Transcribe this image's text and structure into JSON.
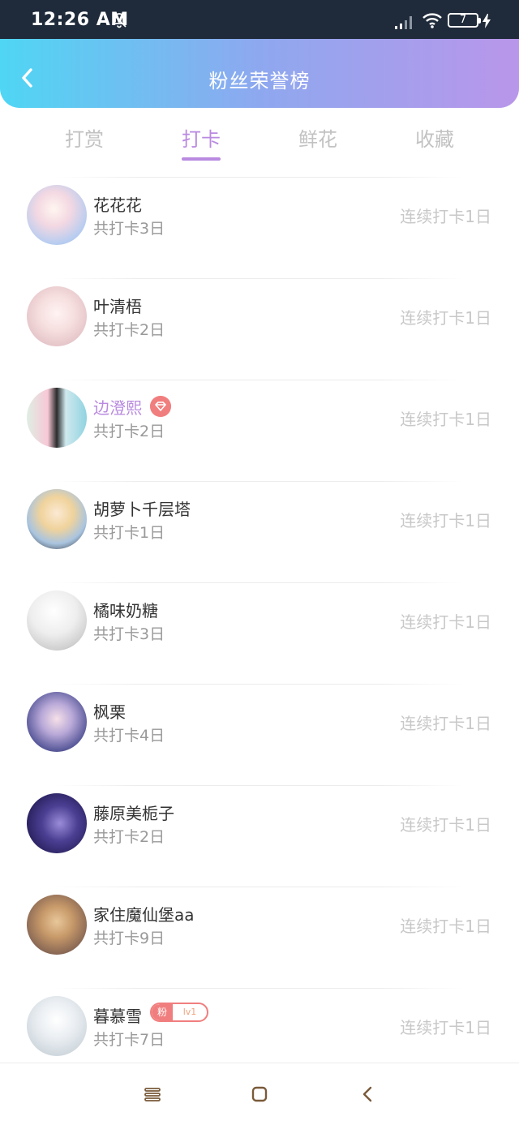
{
  "status_bar": {
    "time": "12:26 AM",
    "battery": "7"
  },
  "header": {
    "title": "粉丝荣誉榜"
  },
  "tabs": [
    {
      "label": "打赏",
      "active": false
    },
    {
      "label": "打卡",
      "active": true
    },
    {
      "label": "鲜花",
      "active": false
    },
    {
      "label": "收藏",
      "active": false
    }
  ],
  "colors": {
    "accent": "#b98ae0",
    "header_start": "#4fd6f4",
    "header_end": "#b996ea",
    "badge": "#f17e7e"
  },
  "rows": [
    {
      "name": "花花花",
      "total": "共打卡3日",
      "streak": "连续打卡1日",
      "avatar_icon": "avatar-icon"
    },
    {
      "name": "叶清梧",
      "total": "共打卡2日",
      "streak": "连续打卡1日",
      "avatar_icon": "avatar-icon"
    },
    {
      "name": "边澄熙",
      "total": "共打卡2日",
      "streak": "连续打卡1日",
      "avatar_icon": "avatar-icon",
      "badge": "diamond-icon"
    },
    {
      "name": "胡萝卜千层塔",
      "total": "共打卡1日",
      "streak": "连续打卡1日",
      "avatar_icon": "avatar-icon"
    },
    {
      "name": "橘味奶糖",
      "total": "共打卡3日",
      "streak": "连续打卡1日",
      "avatar_icon": "avatar-icon"
    },
    {
      "name": "枫栗",
      "total": "共打卡4日",
      "streak": "连续打卡1日",
      "avatar_icon": "avatar-icon"
    },
    {
      "name": "藤原美栀子",
      "total": "共打卡2日",
      "streak": "连续打卡1日",
      "avatar_icon": "avatar-icon"
    },
    {
      "name": "家住魔仙堡aa",
      "total": "共打卡9日",
      "streak": "连续打卡1日",
      "avatar_icon": "avatar-icon"
    },
    {
      "name": "暮慕雪",
      "total": "共打卡7日",
      "streak": "连续打卡1日",
      "avatar_icon": "avatar-icon",
      "fan_badge": {
        "label": "粉",
        "level": "lv1"
      }
    }
  ],
  "nav": {
    "menu_icon": "menu-icon",
    "home_icon": "home-icon",
    "back_icon": "back-icon"
  }
}
